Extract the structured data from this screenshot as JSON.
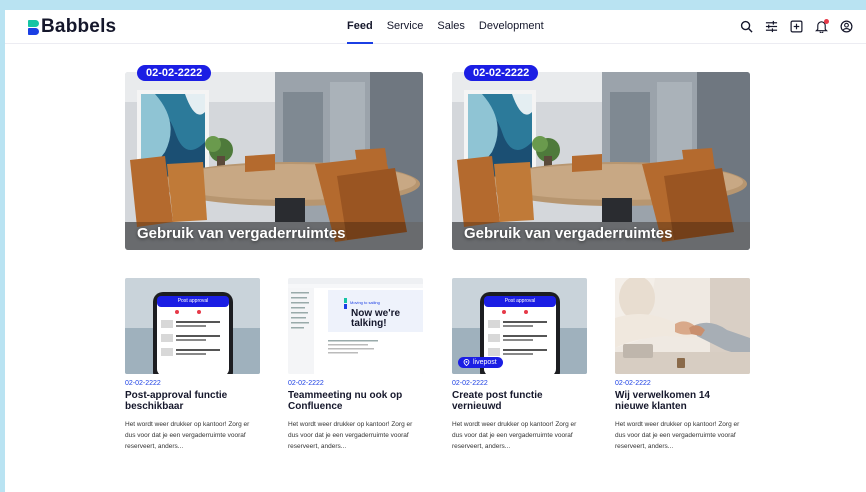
{
  "brand": {
    "name": "Babbels",
    "colors": {
      "accent": "#1b3fe4",
      "teal": "#16c4a4",
      "pill": "#1b1ee4"
    }
  },
  "nav": {
    "items": [
      "Feed",
      "Service",
      "Sales",
      "Development"
    ],
    "active": "Feed"
  },
  "header_icons": [
    "search-icon",
    "filter-icon",
    "add-post-icon",
    "bell-icon",
    "account-icon"
  ],
  "hero": [
    {
      "date": "02-02-2222",
      "title": "Gebruik van vergaderruimtes"
    },
    {
      "date": "02-02-2222",
      "title": "Gebruik van vergaderruimtes"
    }
  ],
  "cards": [
    {
      "date": "02-02-2222",
      "title": "Post-approval functie beschikbaar",
      "text": "Het wordt weer drukker op kantoor! Zorg er dus voor dat je een vergaderruimte vooraf reserveert, anders..."
    },
    {
      "date": "02-02-2222",
      "title": "Teammeeting nu ook op Confluence",
      "text": "Het wordt weer drukker op kantoor! Zorg er dus voor dat je een vergaderruimte vooraf reserveert, anders..."
    },
    {
      "date": "02-02-2222",
      "title": "Create post functie vernieuwd",
      "text": "Het wordt weer drukker op kantoor! Zorg er dus voor dat je een vergaderruimte vooraf reserveert, anders...",
      "badge": "livepost"
    },
    {
      "date": "02-02-2222",
      "title": "Wij verwelkomen 14 nieuwe klanten",
      "text": "Het wordt weer drukker op kantoor! Zorg er dus voor dat je een vergaderruimte vooraf reserveert, anders..."
    }
  ],
  "screens": {
    "phone": {
      "header": "Post approval",
      "row_text": "Hoogstaand: Hoe je een categorie maakt dat beste hoog is"
    },
    "confluence": {
      "small": "Moving to sailing",
      "headline": "Now we're talking!"
    }
  }
}
